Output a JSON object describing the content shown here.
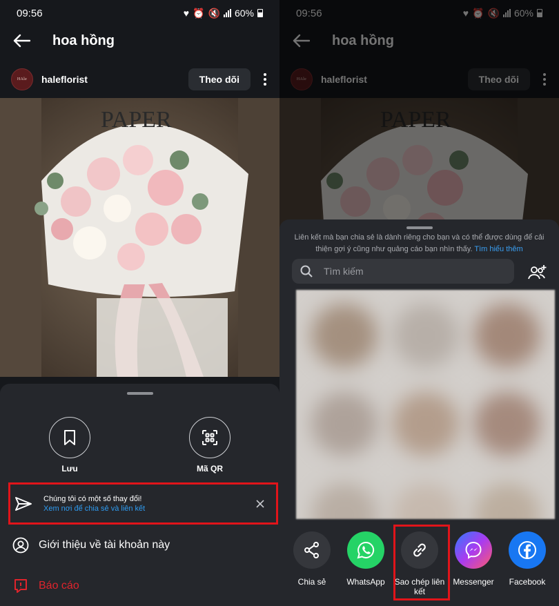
{
  "status": {
    "time": "09:56",
    "battery": "60%"
  },
  "post": {
    "title": "hoa hồng",
    "username": "haleflorist",
    "avatar_text": "HAle",
    "follow_label": "Theo dõi",
    "photo_text": "PAPER"
  },
  "left_sheet": {
    "save_label": "Lưu",
    "qr_label": "Mã QR",
    "notice_title": "Chúng tôi có một số thay đổi!",
    "notice_link": "Xem nơi để chia sẻ và liên kết",
    "about_label": "Giới thiệu về tài khoản này",
    "report_label": "Báo cáo"
  },
  "right_sheet": {
    "note_text": "Liên kết mà bạn chia sẻ là dành riêng cho bạn và có thể được dùng để cải thiện gợi ý cũng như quảng cáo bạn nhìn thấy.",
    "note_link": "Tìm hiểu thêm",
    "search_placeholder": "Tìm kiếm",
    "apps": [
      {
        "label": "Chia sẻ",
        "icon": "share-icon",
        "color": "#35373c"
      },
      {
        "label": "WhatsApp",
        "icon": "whatsapp-icon",
        "color": "#25d366"
      },
      {
        "label": "Sao chép liên kết",
        "icon": "link-icon",
        "color": "#35373c"
      },
      {
        "label": "Messenger",
        "icon": "messenger-icon",
        "color": "#a93bf0"
      },
      {
        "label": "Facebook",
        "icon": "facebook-icon",
        "color": "#1877f2"
      }
    ]
  },
  "colors": {
    "accent_link": "#2e9bf0",
    "highlight": "#e1141a",
    "report": "#e0242c"
  }
}
